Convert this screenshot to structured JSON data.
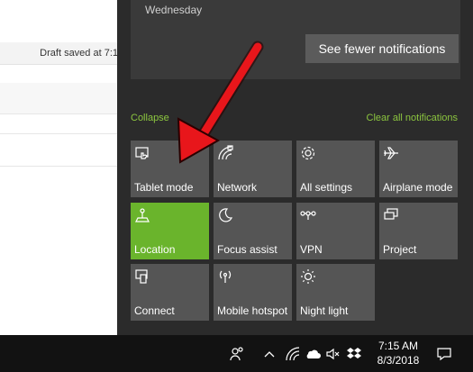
{
  "document": {
    "draft_status": "Draft saved at 7:1"
  },
  "notification": {
    "day": "Wednesday",
    "see_fewer_label": "See fewer notifications"
  },
  "action_center": {
    "collapse_label": "Collapse",
    "clear_all_label": "Clear all notifications",
    "tiles": [
      {
        "label": "Tablet mode",
        "icon": "tablet-mode-icon",
        "active": false
      },
      {
        "label": "Network",
        "icon": "network-icon",
        "active": false
      },
      {
        "label": "All settings",
        "icon": "gear-icon",
        "active": false
      },
      {
        "label": "Airplane mode",
        "icon": "airplane-icon",
        "active": false
      },
      {
        "label": "Location",
        "icon": "location-icon",
        "active": true
      },
      {
        "label": "Focus assist",
        "icon": "moon-icon",
        "active": false
      },
      {
        "label": "VPN",
        "icon": "vpn-icon",
        "active": false
      },
      {
        "label": "Project",
        "icon": "project-icon",
        "active": false
      },
      {
        "label": "Connect",
        "icon": "connect-icon",
        "active": false
      },
      {
        "label": "Mobile hotspot",
        "icon": "hotspot-icon",
        "active": false
      },
      {
        "label": "Night light",
        "icon": "brightness-icon",
        "active": false
      }
    ]
  },
  "taskbar": {
    "time": "7:15 AM",
    "date": "8/3/2018"
  },
  "colors": {
    "accent_green": "#8cc63f",
    "active_tile": "#6ab42c",
    "arrow_red": "#e8161b"
  }
}
